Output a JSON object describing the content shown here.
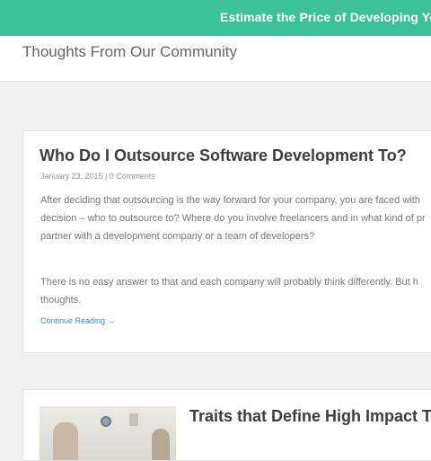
{
  "banner": {
    "text": "Estimate the Price of Developing Your"
  },
  "header": {
    "title": "Thoughts From Our Community"
  },
  "posts": [
    {
      "title": "Who Do I Outsource Software Development To?",
      "date": "January 23, 2015",
      "separator": " | ",
      "comments": "0 Comments",
      "paragraphs": [
        [
          "After deciding that outsourcing is the way forward for your company, you are faced with",
          "decision – who to outsource to? Where do you involve freelancers and in what kind of pr",
          "partner with a development company or a team of developers?"
        ],
        [
          "There is no easy answer to that and each company will probably think differently. But h",
          "thoughts."
        ]
      ],
      "continue_label": "Continue Reading →"
    },
    {
      "title": "Traits that Define High Impact Tea"
    }
  ]
}
